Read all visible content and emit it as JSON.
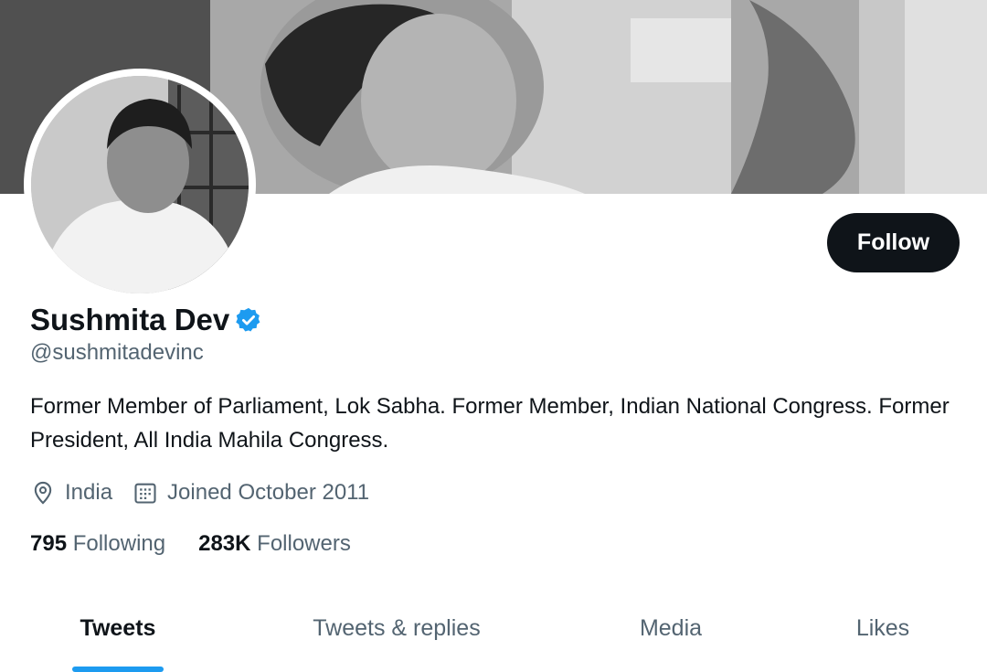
{
  "profile": {
    "display_name": "Sushmita Dev",
    "verified_icon": "verified-badge-icon",
    "handle": "@sushmitadevinc",
    "bio": "Former Member of Parliament, Lok Sabha. Former Member, Indian National Congress. Former President, All India Mahila Congress.",
    "location": "India",
    "location_icon": "location-pin-icon",
    "joined": "Joined October 2011",
    "joined_icon": "calendar-icon"
  },
  "actions": {
    "follow_label": "Follow"
  },
  "stats": {
    "following_count": "795",
    "following_label": "Following",
    "followers_count": "283K",
    "followers_label": "Followers"
  },
  "tabs": [
    {
      "label": "Tweets",
      "active": true
    },
    {
      "label": "Tweets & replies",
      "active": false
    },
    {
      "label": "Media",
      "active": false
    },
    {
      "label": "Likes",
      "active": false
    }
  ],
  "colors": {
    "accent": "#1d9bf0",
    "text_primary": "#0f1419",
    "text_secondary": "#536471",
    "button_bg": "#0f1419"
  }
}
